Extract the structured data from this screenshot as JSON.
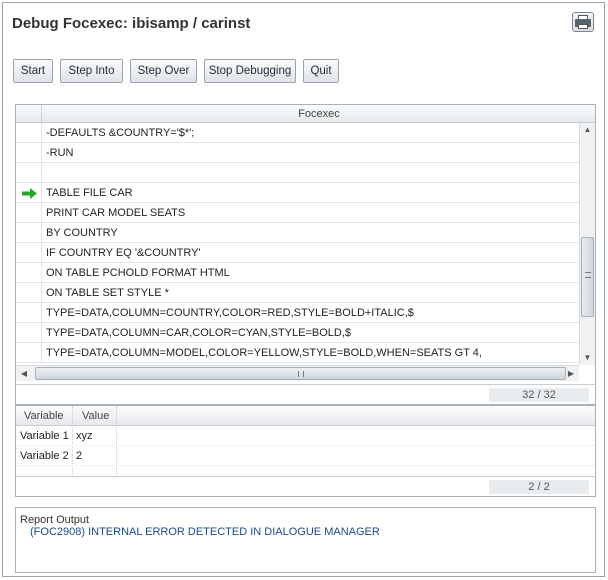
{
  "window": {
    "title": "Debug Focexec: ibisamp / carinst"
  },
  "icons": {
    "print": "printer-icon",
    "current_line": "green-arrow-icon"
  },
  "toolbar": {
    "start_label": "Start",
    "step_into_label": "Step Into",
    "step_over_label": "Step Over",
    "stop_debugging_label": "Stop Debugging",
    "quit_label": "Quit"
  },
  "focexec": {
    "header": "Focexec",
    "lines": [
      "-DEFAULTS &COUNTRY='$*';",
      "-RUN",
      "",
      "TABLE FILE CAR",
      "PRINT CAR MODEL SEATS",
      "BY COUNTRY",
      "IF COUNTRY EQ '&COUNTRY'",
      "ON TABLE PCHOLD FORMAT HTML",
      "ON TABLE SET STYLE *",
      "TYPE=DATA,COLUMN=COUNTRY,COLOR=RED,STYLE=BOLD+ITALIC,$",
      "TYPE=DATA,COLUMN=CAR,COLOR=CYAN,STYLE=BOLD,$",
      "TYPE=DATA,COLUMN=MODEL,COLOR=YELLOW,STYLE=BOLD,WHEN=SEATS GT 4,"
    ],
    "current_line_index": 3,
    "counter": "32 / 32"
  },
  "variables": {
    "columns": [
      "Variable",
      "Value"
    ],
    "rows": [
      {
        "name": "Variable 1",
        "value": "xyz"
      },
      {
        "name": "Variable 2",
        "value": "2"
      }
    ],
    "counter": "2 / 2"
  },
  "report": {
    "label": "Report Output",
    "message": "(FOC2908)  INTERNAL ERROR DETECTED IN DIALOGUE MANAGER"
  },
  "colors": {
    "arrow": "#2aa52a",
    "error_text": "#1a4a8a"
  }
}
